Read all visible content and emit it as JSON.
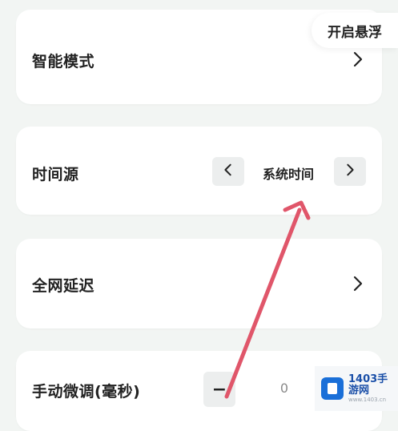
{
  "float_button": {
    "label": "开启悬浮"
  },
  "settings": {
    "smart_mode": {
      "label": "智能模式"
    },
    "time_source": {
      "label": "时间源",
      "value": "系统时间"
    },
    "network_delay": {
      "label": "全网延迟"
    },
    "manual_adjust": {
      "label": "手动微调(毫秒)",
      "minus": "−",
      "value": "0"
    }
  },
  "watermark": {
    "name": "1403手游网",
    "sub": "www.1403.cn",
    "brand_color": "#1a6fd8"
  },
  "colors": {
    "background": "#f2f5f3",
    "card": "#ffffff",
    "annotation_arrow": "#e0566a"
  }
}
